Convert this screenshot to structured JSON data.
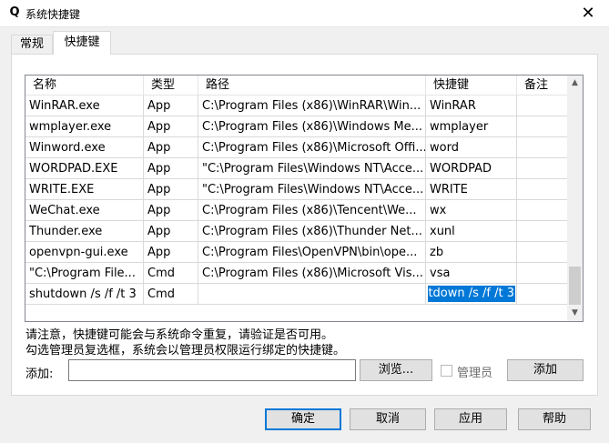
{
  "window": {
    "title": "系统快捷键",
    "app_icon_glyph": "Q",
    "close_glyph": "✕"
  },
  "tabs": [
    {
      "label": "常规",
      "active": false
    },
    {
      "label": "快捷键",
      "active": true
    }
  ],
  "grid": {
    "columns": [
      "名称",
      "类型",
      "路径",
      "快捷键",
      "备注"
    ],
    "rows": [
      {
        "name": "WinRAR.exe",
        "type": "App",
        "path": "C:\\Program Files (x86)\\WinRAR\\Win...",
        "hotkey": "WinRAR",
        "note": ""
      },
      {
        "name": "wmplayer.exe",
        "type": "App",
        "path": "C:\\Program Files (x86)\\Windows Me...",
        "hotkey": "wmplayer",
        "note": ""
      },
      {
        "name": "Winword.exe",
        "type": "App",
        "path": "C:\\Program Files (x86)\\Microsoft Offi...",
        "hotkey": "word",
        "note": ""
      },
      {
        "name": "WORDPAD.EXE",
        "type": "App",
        "path": "\"C:\\Program Files\\Windows NT\\Acce...",
        "hotkey": "WORDPAD",
        "note": ""
      },
      {
        "name": "WRITE.EXE",
        "type": "App",
        "path": "\"C:\\Program Files\\Windows NT\\Acce...",
        "hotkey": "WRITE",
        "note": ""
      },
      {
        "name": "WeChat.exe",
        "type": "App",
        "path": "C:\\Program Files (x86)\\Tencent\\We...",
        "hotkey": "wx",
        "note": ""
      },
      {
        "name": "Thunder.exe",
        "type": "App",
        "path": "C:\\Program Files (x86)\\Thunder Net...",
        "hotkey": "xunl",
        "note": ""
      },
      {
        "name": "openvpn-gui.exe",
        "type": "App",
        "path": "C:\\Program Files\\OpenVPN\\bin\\ope...",
        "hotkey": "zb",
        "note": ""
      },
      {
        "name": "\"C:\\Program File...",
        "type": "Cmd",
        "path": "C:\\Program Files (x86)\\Microsoft Vis...",
        "hotkey": "vsa",
        "note": ""
      },
      {
        "name": "shutdown /s /f /t 3",
        "type": "Cmd",
        "path": "",
        "hotkey": "",
        "note": ""
      }
    ],
    "editing_value": "shutdown /s /f /t 3",
    "scroll_up_glyph": "▲",
    "scroll_down_glyph": "▼"
  },
  "notes": {
    "line1": "请注意，快捷键可能会与系统命令重复，请验证是否可用。",
    "line2": "勾选管理员复选框，系统会以管理员权限运行绑定的快捷键。"
  },
  "add_row": {
    "label": "添加:",
    "input_value": "",
    "browse_label": "浏览...",
    "admin_label": "管理员",
    "admin_checked": false,
    "add_label": "添加"
  },
  "footer": {
    "ok_label": "确定",
    "cancel_label": "取消",
    "apply_label": "应用",
    "help_label": "帮助"
  }
}
